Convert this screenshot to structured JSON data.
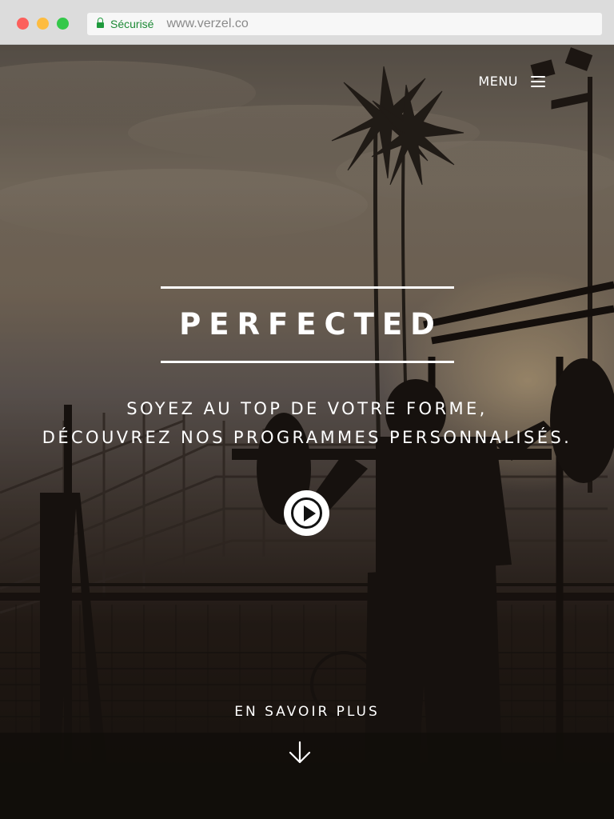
{
  "browser": {
    "secure_label": "Sécurisé",
    "url": "www.verzel.co"
  },
  "nav": {
    "menu_label": "MENU"
  },
  "hero": {
    "title": "PERFECTED",
    "tagline_line1": "SOYEZ AU TOP DE VOTRE FORME,",
    "tagline_line2": "DÉCOUVREZ NOS PROGRAMMES PERSONNALISÉS.",
    "learn_more": "EN SAVOIR PLUS"
  },
  "icons": {
    "menu": "hamburger-icon",
    "play": "play-icon",
    "arrow": "arrow-down-icon",
    "secure": "lock-icon"
  },
  "colors": {
    "secure_green": "#1e8a36",
    "text": "#ffffff"
  }
}
